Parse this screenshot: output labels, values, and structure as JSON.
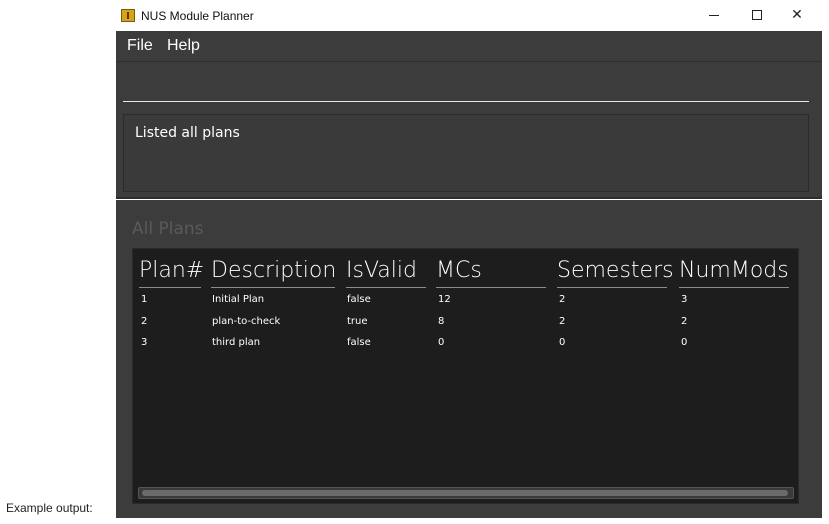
{
  "caption": "Example output:",
  "window": {
    "title": "NUS Module Planner",
    "controls": {
      "minimize": "—",
      "maximize": "☐",
      "close": "✕"
    }
  },
  "menu": {
    "file": "File",
    "help": "Help"
  },
  "command": {
    "value": "",
    "placeholder": ""
  },
  "result": {
    "text": "Listed all plans"
  },
  "plans": {
    "title": "All Plans",
    "columns": [
      "Plan#",
      "Description",
      "IsValid",
      "MCs",
      "Semesters",
      "NumMods"
    ],
    "rows": [
      [
        "1",
        "Initial Plan",
        "false",
        "12",
        "2",
        "3"
      ],
      [
        "2",
        "plan-to-check",
        "true",
        "8",
        "2",
        "2"
      ],
      [
        "3",
        "third plan",
        "false",
        "0",
        "0",
        "0"
      ]
    ]
  }
}
